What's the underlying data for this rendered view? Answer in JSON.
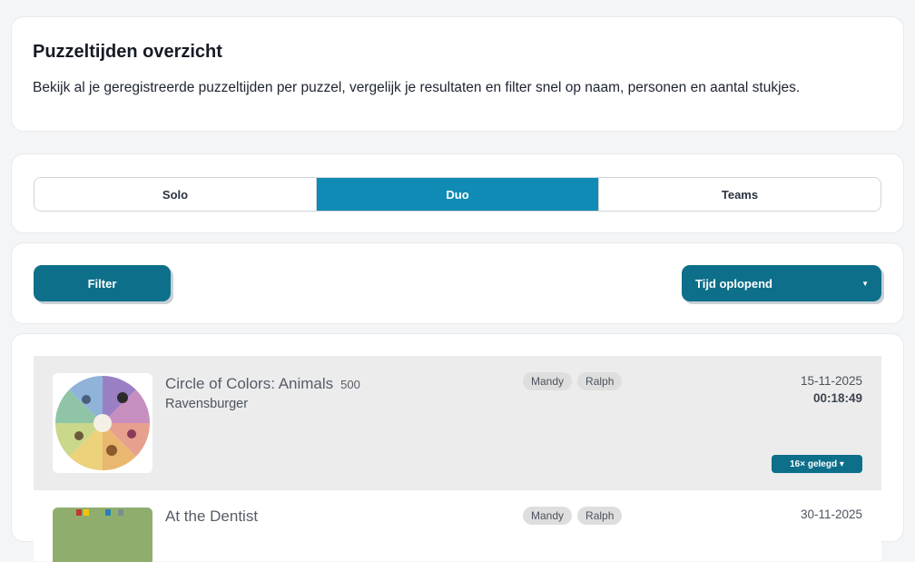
{
  "header": {
    "title": "Puzzeltijden overzicht",
    "subtitle": "Bekijk al je geregistreerde puzzeltijden per puzzel, vergelijk je resultaten en filter snel op naam, personen en aantal stukjes."
  },
  "tabs": [
    {
      "label": "Solo",
      "active": false
    },
    {
      "label": "Duo",
      "active": true
    },
    {
      "label": "Teams",
      "active": false
    }
  ],
  "toolbar": {
    "filter_label": "Filter",
    "sort_selected": "Tijd oplopend",
    "caret_icon": "chevron-down-icon"
  },
  "colors": {
    "accent": "#0e6f8a",
    "tab_active": "#0f8bb5",
    "row_highlight": "#ececec"
  },
  "entries": [
    {
      "name": "Circle of Colors: Animals",
      "pieces": "500",
      "brand": "Ravensburger",
      "people": [
        "Mandy",
        "Ralph"
      ],
      "date": "15-11-2025",
      "time": "00:18:49",
      "played": "16× gelegd ▾"
    },
    {
      "name": "At the Dentist",
      "pieces": "",
      "brand": "",
      "people": [
        "Mandy",
        "Ralph"
      ],
      "date": "30-11-2025",
      "time": "",
      "played": ""
    }
  ]
}
